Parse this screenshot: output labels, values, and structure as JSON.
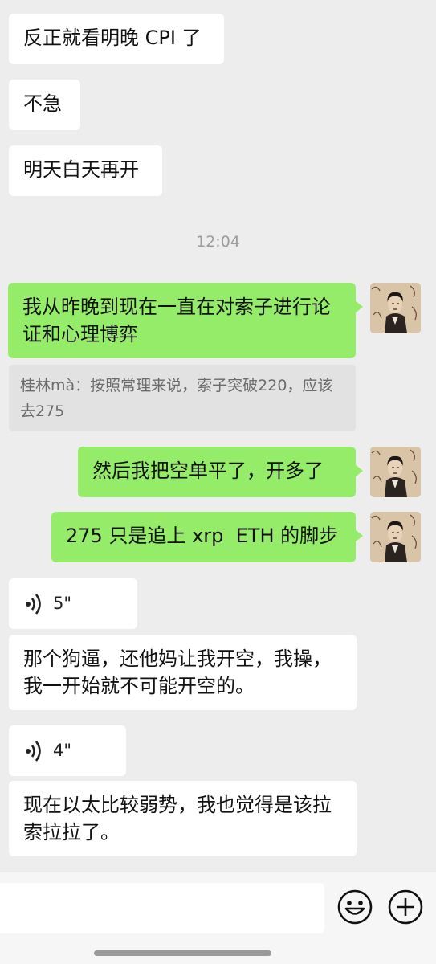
{
  "messages": {
    "m1": "反正就看明晚 CPI 了",
    "m2": "不急",
    "m3": "明天白天再开",
    "time": "12:04",
    "m4": "我从昨晚到现在一直在对索子进行论证和心理博弈",
    "quote": "桂林mà：按照常理来说，索子突破220，应该去275",
    "m5": "然后我把空单平了，开多了",
    "m6": "275 只是追上 xrp  ETH 的脚步",
    "voice1": "5\"",
    "m7": "那个狗逼，还他妈让我开空，我操，我一开始就不可能开空的。",
    "voice2": "4\"",
    "m8": "现在以太比较弱势，我也觉得是该拉索拉拉了。"
  },
  "icons": {
    "voice": "voice-wave-icon",
    "emoji": "smiley-face-icon",
    "more": "plus-circle-icon"
  },
  "colors": {
    "background": "#ededed",
    "outgoing_bubble": "#95ec69",
    "incoming_bubble": "#ffffff"
  }
}
